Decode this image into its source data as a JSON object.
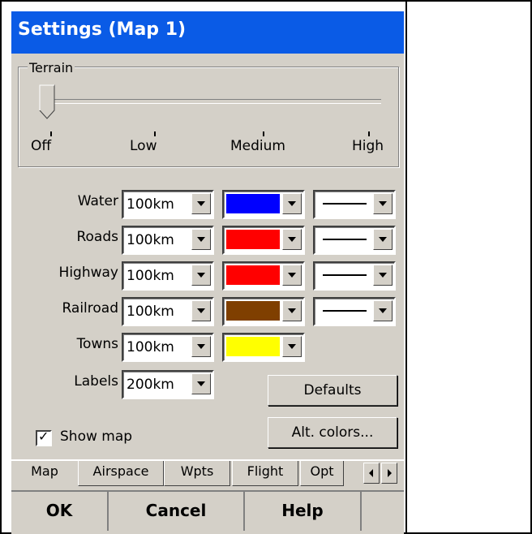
{
  "window": {
    "title": "Settings (Map 1)"
  },
  "terrain": {
    "legend": "Terrain",
    "level": "Off",
    "ticks": [
      "Off",
      "Low",
      "Medium",
      "High"
    ]
  },
  "rows": [
    {
      "label": "Water",
      "range": "100km",
      "color": "#0000ff",
      "has_line": true
    },
    {
      "label": "Roads",
      "range": "100km",
      "color": "#ff0000",
      "has_line": true
    },
    {
      "label": "Highway",
      "range": "100km",
      "color": "#ff0000",
      "has_line": true
    },
    {
      "label": "Railroad",
      "range": "100km",
      "color": "#7f3f00",
      "has_line": true
    },
    {
      "label": "Towns",
      "range": "100km",
      "color": "#ffff00",
      "has_line": false
    },
    {
      "label": "Labels",
      "range": "200km",
      "color": null,
      "has_line": false
    }
  ],
  "buttons": {
    "defaults": "Defaults",
    "alt_colors": "Alt. colors..."
  },
  "show_map": {
    "label": "Show map",
    "checked": true
  },
  "tabs": [
    "Map",
    "Airspace",
    "Wpts",
    "Flight",
    "Opt"
  ],
  "tab_scroll": {
    "left_icon": "arrow-left-icon",
    "right_icon": "arrow-right-icon"
  },
  "dialog_buttons": {
    "ok": "OK",
    "cancel": "Cancel",
    "help": "Help"
  },
  "colors": {
    "titlebar": "#0a5be6",
    "face": "#d4d0c8"
  }
}
